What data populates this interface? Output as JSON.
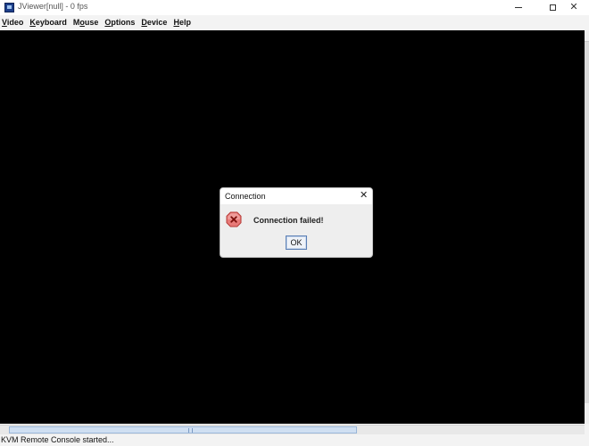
{
  "window": {
    "title": "JViewer[null] - 0 fps"
  },
  "menubar": {
    "items": [
      {
        "label": "Video",
        "mnemonic": "V",
        "rest": "ideo"
      },
      {
        "label": "Keyboard",
        "mnemonic": "K",
        "rest": "eyboard"
      },
      {
        "label": "Mouse",
        "mnemonic": "o",
        "pre": "M",
        "rest": "use"
      },
      {
        "label": "Options",
        "mnemonic": "O",
        "rest": "ptions"
      },
      {
        "label": "Device",
        "mnemonic": "D",
        "rest": "evice"
      },
      {
        "label": "Help",
        "mnemonic": "H",
        "rest": "elp"
      }
    ]
  },
  "dialog": {
    "title": "Connection",
    "message": "Connection failed!",
    "icon": "error-icon",
    "ok_label": "OK"
  },
  "statusbar": {
    "text": "KVM Remote Console started..."
  },
  "colors": {
    "viewer_background": "#000000",
    "error_icon": "#d9534f"
  }
}
